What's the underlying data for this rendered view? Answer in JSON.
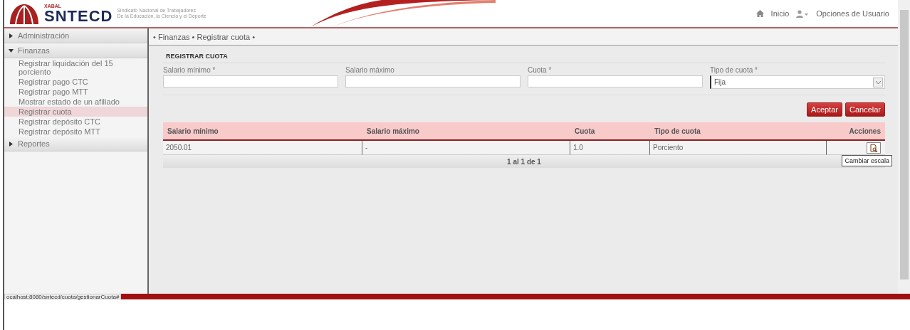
{
  "header": {
    "logo_small": "XABAL",
    "logo": "SNTECD",
    "tagline": [
      "Sindicato Nacional de Trabajadores",
      "De la Educación, la Ciencia y el Deporte"
    ],
    "nav": [
      {
        "kind": "home",
        "label": "Inicio"
      },
      {
        "kind": "user",
        "label": "Opciones de Usuario"
      }
    ]
  },
  "sidebar": [
    {
      "label": "Administración",
      "expanded": false
    },
    {
      "label": "Finanzas",
      "expanded": true,
      "children": [
        {
          "label": "Registrar liquidación del 15 porciento",
          "selected": false
        },
        {
          "label": "Registrar pago CTC",
          "selected": false
        },
        {
          "label": "Registrar pago MTT",
          "selected": false
        },
        {
          "label": "Mostrar estado de un afiliado",
          "selected": false
        },
        {
          "label": "Registrar cuota",
          "selected": true
        },
        {
          "label": "Registrar depósito CTC",
          "selected": false
        },
        {
          "label": "Registrar depósito MTT",
          "selected": false
        }
      ]
    },
    {
      "label": "Reportes",
      "expanded": false
    }
  ],
  "breadcrumb": "• Finanzas • Registrar cuota •",
  "form": {
    "title": "REGISTRAR CUOTA",
    "fields": [
      {
        "kind": "input",
        "label": "Salario mínimo *"
      },
      {
        "kind": "input",
        "label": "Salario máximo"
      },
      {
        "kind": "input",
        "label": "Cuota *"
      },
      {
        "kind": "select",
        "label": "Tipo de cuota *",
        "value": "Fija"
      }
    ],
    "buttons": [
      "Aceptar",
      "Cancelar"
    ]
  },
  "table": {
    "columns": [
      "Salario mínimo",
      "Salario máximo",
      "Cuota",
      "Tipo de cuota",
      "Acciones"
    ],
    "rows": [
      [
        "2050.01",
        "-",
        "1.0",
        "Porciento"
      ]
    ],
    "pager": "1 al 1 de 1",
    "tooltip": "Cambiar escala"
  },
  "status_url": "ocalhost:8080/sntecd/cuota/gestionarCuota#"
}
